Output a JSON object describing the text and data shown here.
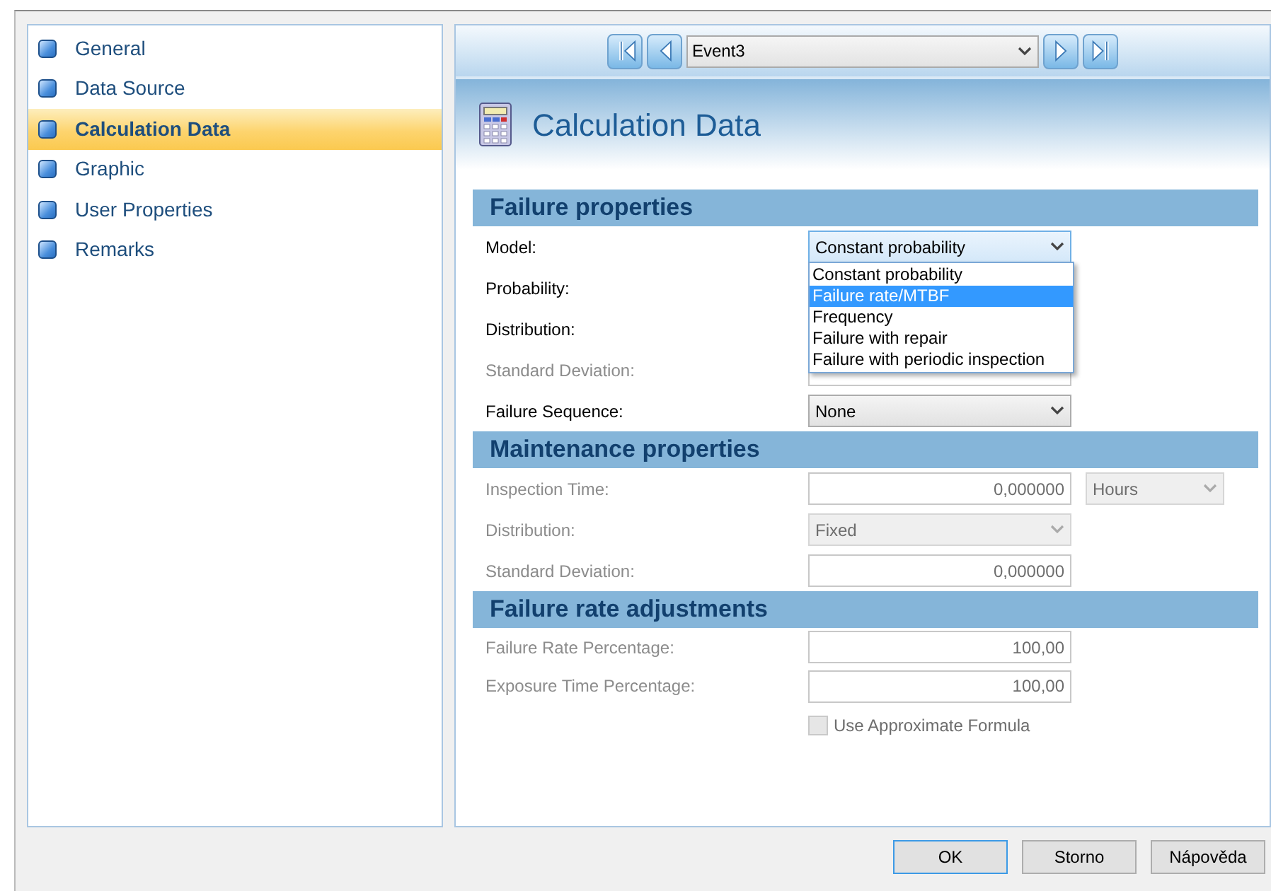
{
  "sidebar": {
    "items": [
      {
        "label": "General",
        "selected": false
      },
      {
        "label": "Data Source",
        "selected": false
      },
      {
        "label": "Calculation Data",
        "selected": true
      },
      {
        "label": "Graphic",
        "selected": false
      },
      {
        "label": "User Properties",
        "selected": false
      },
      {
        "label": "Remarks",
        "selected": false
      }
    ]
  },
  "navigator": {
    "record": "Event3"
  },
  "page_title": "Calculation Data",
  "sections": [
    {
      "title": "Failure properties",
      "rows": [
        {
          "label": "Model:",
          "kind": "select",
          "disabled": false,
          "focused": true,
          "value": "Constant probability",
          "open_list": [
            {
              "label": "Constant probability",
              "highlighted": false
            },
            {
              "label": "Failure rate/MTBF",
              "highlighted": true
            },
            {
              "label": "Frequency",
              "highlighted": false
            },
            {
              "label": "Failure with repair",
              "highlighted": false
            },
            {
              "label": "Failure with periodic inspection",
              "highlighted": false
            }
          ]
        },
        {
          "label": "Probability:",
          "kind": "covered",
          "disabled": false
        },
        {
          "label": "Distribution:",
          "kind": "covered",
          "disabled": false
        },
        {
          "label": "Standard Deviation:",
          "kind": "text",
          "disabled": true
        },
        {
          "label": "Failure Sequence:",
          "kind": "select",
          "disabled": false,
          "focused": false,
          "value": "None"
        }
      ]
    },
    {
      "title": "Maintenance properties",
      "rows": [
        {
          "label": "Inspection Time:",
          "kind": "text",
          "disabled": true,
          "value": "0,000000",
          "unit": "Hours"
        },
        {
          "label": "Distribution:",
          "kind": "select",
          "disabled": true,
          "focused": false,
          "value": "Fixed"
        },
        {
          "label": "Standard Deviation:",
          "kind": "text",
          "disabled": true,
          "value": "0,000000"
        }
      ]
    },
    {
      "title": "Failure rate adjustments",
      "rows": [
        {
          "label": "Failure Rate Percentage:",
          "kind": "text",
          "disabled": true,
          "value": "100,00"
        },
        {
          "label": "Exposure Time Percentage:",
          "kind": "text",
          "disabled": true,
          "value": "100,00"
        },
        {
          "label": "Use Approximate Formula",
          "kind": "checkbox",
          "disabled": true,
          "checked": false
        }
      ]
    }
  ],
  "buttons": [
    {
      "label": "OK",
      "default": true
    },
    {
      "label": "Storno",
      "default": false
    },
    {
      "label": "Nápověda",
      "default": false
    }
  ]
}
